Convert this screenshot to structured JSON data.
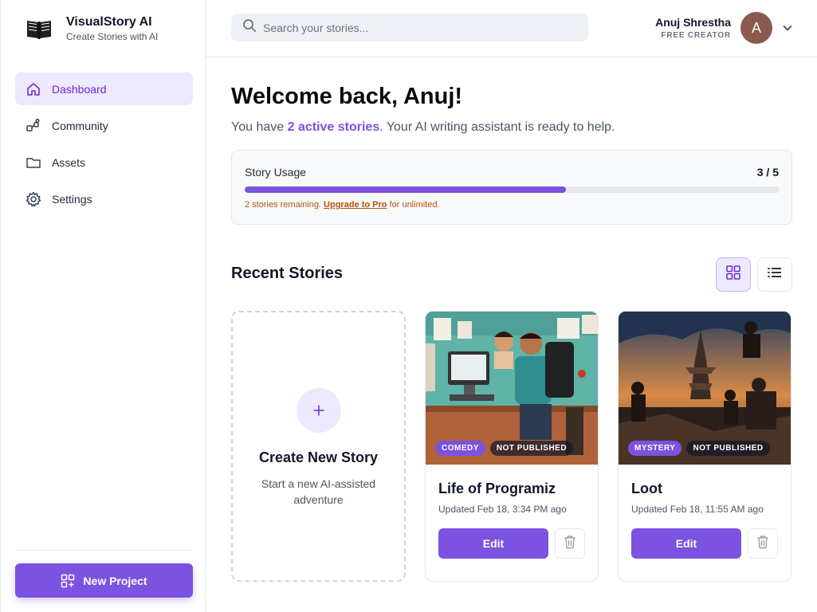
{
  "brand": {
    "title": "VisualStory AI",
    "subtitle": "Create Stories with AI",
    "logo_icon": "book-icon"
  },
  "sidebar": {
    "items": [
      {
        "label": "Dashboard",
        "icon": "home-icon",
        "active": true
      },
      {
        "label": "Community",
        "icon": "community-icon",
        "active": false
      },
      {
        "label": "Assets",
        "icon": "folder-icon",
        "active": false
      },
      {
        "label": "Settings",
        "icon": "gear-icon",
        "active": false
      }
    ],
    "new_project_label": "New Project"
  },
  "header": {
    "search_placeholder": "Search your stories...",
    "user_name": "Anuj Shrestha",
    "user_plan": "FREE CREATOR",
    "avatar_initial": "A"
  },
  "welcome": {
    "title": "Welcome back, Anuj!",
    "sub_prefix": "You have ",
    "sub_highlight": "2 active stories",
    "sub_suffix": ". Your AI writing assistant is ready to help."
  },
  "usage": {
    "title": "Story Usage",
    "count": "3 / 5",
    "used": 3,
    "total": 5,
    "note_prefix": "2 stories remaining. ",
    "note_link": "Upgrade to Pro",
    "note_suffix": " for unlimited."
  },
  "recent": {
    "title": "Recent Stories",
    "create_card": {
      "title": "Create New Story",
      "subtitle": "Start a new AI-assisted adventure"
    },
    "stories": [
      {
        "title": "Life of Programiz",
        "genre": "COMEDY",
        "status": "NOT PUBLISHED",
        "updated": "Updated Feb 18, 3:34 PM ago",
        "edit_label": "Edit"
      },
      {
        "title": "Loot",
        "genre": "MYSTERY",
        "status": "NOT PUBLISHED",
        "updated": "Updated Feb 18, 11:55 AM ago",
        "edit_label": "Edit"
      }
    ]
  },
  "colors": {
    "accent": "#7c52e0",
    "accent_light": "#ede9fe",
    "warning": "#b45309"
  }
}
